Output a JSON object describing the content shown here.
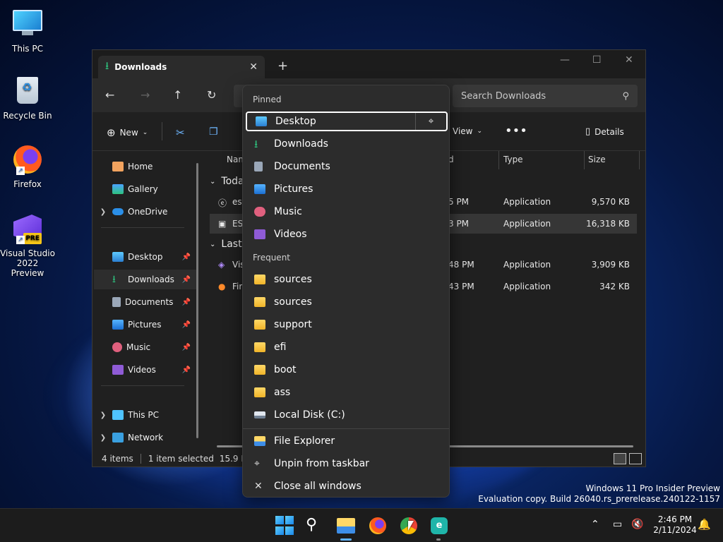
{
  "desktop": {
    "icons": [
      {
        "label": "This PC",
        "icon": "monitor-icon"
      },
      {
        "label": "Recycle Bin",
        "icon": "recycle-bin-icon"
      },
      {
        "label": "Firefox",
        "icon": "firefox-icon"
      },
      {
        "label": "Visual Studio 2022 Preview",
        "icon": "visual-studio-icon",
        "badge": "PRE"
      }
    ]
  },
  "explorer": {
    "tab_title": "Downloads",
    "search_placeholder": "Search Downloads",
    "toolbar": {
      "new_label": "New",
      "view_label": "View",
      "details_label": "Details"
    },
    "nav": {
      "home": "Home",
      "gallery": "Gallery",
      "onedrive": "OneDrive",
      "desktop": "Desktop",
      "downloads": "Downloads",
      "documents": "Documents",
      "pictures": "Pictures",
      "music": "Music",
      "videos": "Videos",
      "thispc": "This PC",
      "network": "Network"
    },
    "columns": {
      "name": "Nam",
      "date": "d",
      "type": "Type",
      "size": "Size"
    },
    "groups": {
      "today": "Toda",
      "last": "Last"
    },
    "files": [
      {
        "name": "ese",
        "date": "5 PM",
        "type": "Application",
        "size": "9,570 KB"
      },
      {
        "name": "ESI",
        "date": "3 PM",
        "type": "Application",
        "size": "16,318 KB"
      },
      {
        "name": "Vis",
        "date": "48 PM",
        "type": "Application",
        "size": "3,909 KB"
      },
      {
        "name": "Fir",
        "date": "43 PM",
        "type": "Application",
        "size": "342 KB"
      }
    ],
    "status": {
      "count": "4 items",
      "selected": "1 item selected",
      "size": "15.9 MB"
    }
  },
  "jumplist": {
    "pinned_header": "Pinned",
    "pinned": [
      "Desktop",
      "Downloads",
      "Documents",
      "Pictures",
      "Music",
      "Videos"
    ],
    "frequent_header": "Frequent",
    "frequent": [
      "sources",
      "sources",
      "support",
      "efi",
      "boot",
      "ass",
      "Local Disk (C:)"
    ],
    "actions": [
      "File Explorer",
      "Unpin from taskbar",
      "Close all windows"
    ]
  },
  "watermark": {
    "line1": "Windows 11 Pro Insider Preview",
    "line2": "Evaluation copy. Build 26040.rs_prerelease.240122-1157"
  },
  "clock": {
    "time": "2:46 PM",
    "date": "2/11/2024"
  },
  "colors": {
    "accent": "#5fb2ff",
    "downloads": "#2ec27e",
    "folder": "#f0b429"
  }
}
